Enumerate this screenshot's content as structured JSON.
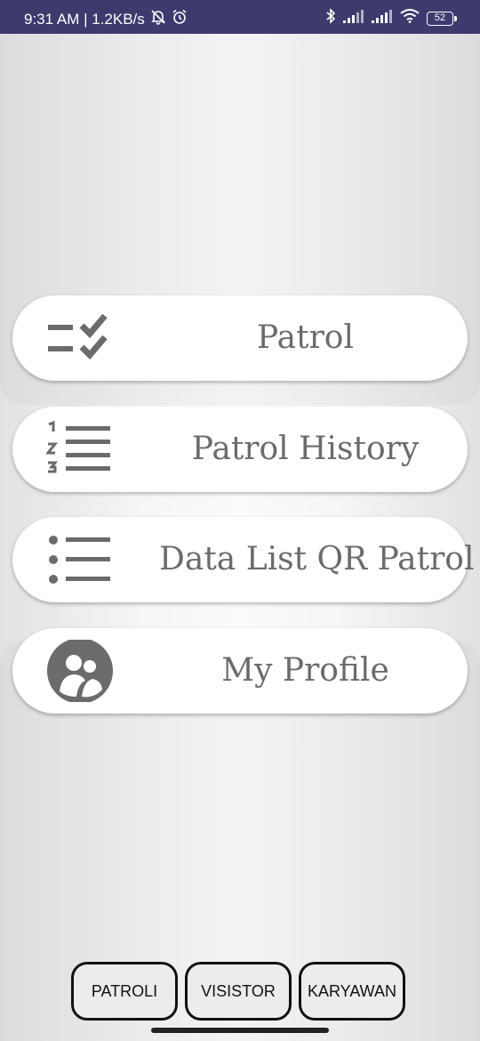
{
  "status_bar": {
    "time_speed": "9:31 AM | 1.2KB/s",
    "battery": "52",
    "icons": [
      "mute-bell-icon",
      "alarm-icon",
      "bluetooth-icon",
      "signal-icon",
      "signal-icon",
      "wifi-icon",
      "battery-icon"
    ]
  },
  "menu": {
    "items": [
      {
        "label": "Patrol",
        "icon": "checklist-icon"
      },
      {
        "label": "Patrol History",
        "icon": "numbered-list-icon"
      },
      {
        "label": "Data List QR Patrol",
        "icon": "bulleted-list-icon"
      },
      {
        "label": "My Profile",
        "icon": "profile-group-icon"
      }
    ]
  },
  "bottom_nav": {
    "patroli": "PATROLI",
    "visistor": "VISISTOR",
    "karyawan": "KARYAWAN"
  },
  "colors": {
    "status_bar": "#3d3b6e",
    "icon_gray": "#6b6b6b",
    "card": "#ffffff"
  }
}
